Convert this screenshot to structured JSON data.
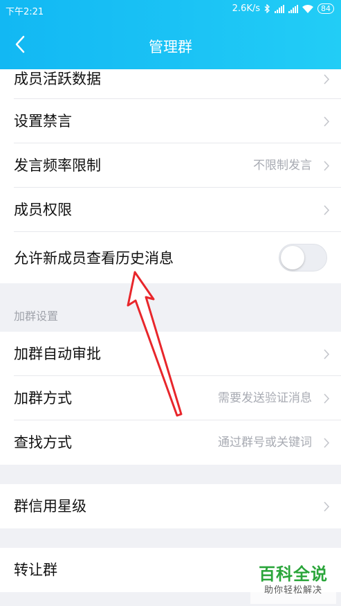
{
  "status_bar": {
    "time": "下午2:21",
    "net_speed": "2.6K/s",
    "battery": "84",
    "icons": [
      "bluetooth-icon",
      "signal-icon",
      "signal-icon",
      "wifi-icon",
      "battery-icon"
    ]
  },
  "header": {
    "title": "管理群",
    "back_icon": "chevron-left-icon",
    "background_color": "#17bff4"
  },
  "items": {
    "member_activity": {
      "label": "成员活跃数据"
    },
    "mute_settings": {
      "label": "设置禁言"
    },
    "speak_rate": {
      "label": "发言频率限制",
      "value": "不限制发言"
    },
    "member_permissions": {
      "label": "成员权限"
    },
    "history_access": {
      "label": "允许新成员查看历史消息",
      "toggle_on": false
    }
  },
  "join_section": {
    "header": "加群设置",
    "auto_approve": {
      "label": "加群自动审批"
    },
    "join_method": {
      "label": "加群方式",
      "value": "需要发送验证消息"
    },
    "search_method": {
      "label": "查找方式",
      "value": "通过群号或关键词"
    }
  },
  "credit": {
    "label": "群信用星级"
  },
  "transfer": {
    "label": "转让群"
  },
  "annotation": {
    "type": "red-arrow",
    "color": "#e8262b"
  },
  "watermark": {
    "logo": "百科全说",
    "subtitle": "助你轻松解决"
  }
}
